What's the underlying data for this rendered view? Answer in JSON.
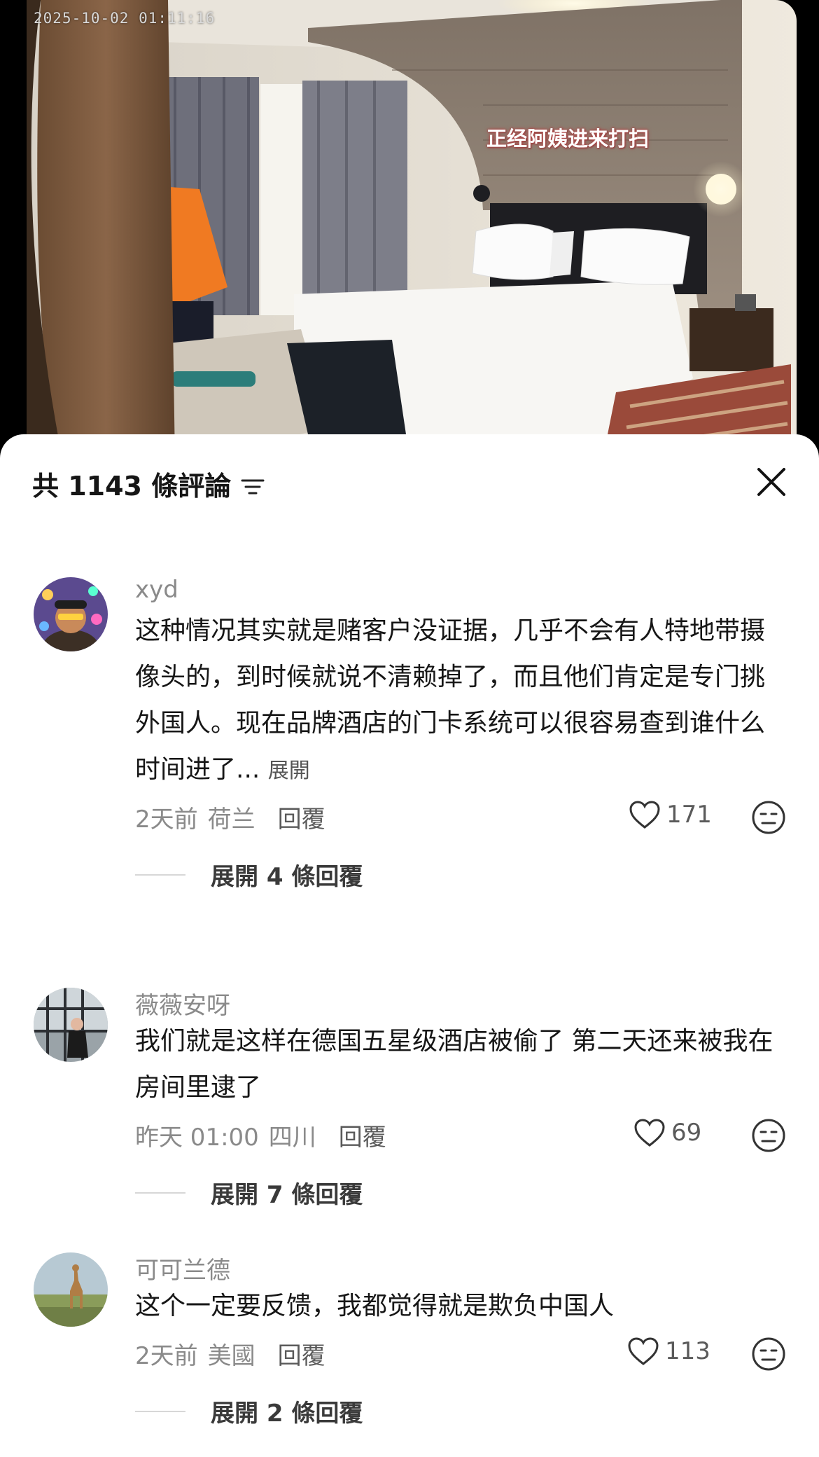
{
  "video": {
    "timestamp": "2025-10-02 01:11:16",
    "caption": "正经阿姨进来打扫"
  },
  "header": {
    "title": "共 1143 條評論",
    "filter_icon": "filter-icon",
    "close_icon": "close-icon"
  },
  "comments": [
    {
      "username": "xyd",
      "text": "这种情况其实就是赌客户没证据，几乎不会有人特地带摄像头的，到时候就说不清赖掉了，而且他们肯定是专门挑外国人。现在品牌酒店的门卡系统可以很容易查到谁什么时间进了...",
      "expand_label": "展開",
      "time": "2天前",
      "location": "荷兰",
      "reply_label": "回覆",
      "likes": "171",
      "replies_label": "展開 4 條回覆"
    },
    {
      "username": "薇薇安呀",
      "text": "我们就是这样在德国五星级酒店被偷了 第二天还来被我在房间里逮了",
      "time": "昨天 01:00",
      "location": "四川",
      "reply_label": "回覆",
      "likes": "69",
      "replies_label": "展開 7 條回覆"
    },
    {
      "username": "可可兰德",
      "text": "这个一定要反馈，我都觉得就是欺负中国人",
      "time": "2天前",
      "location": "美國",
      "reply_label": "回覆",
      "likes": "113",
      "replies_label": "展開 2 條回覆"
    }
  ]
}
